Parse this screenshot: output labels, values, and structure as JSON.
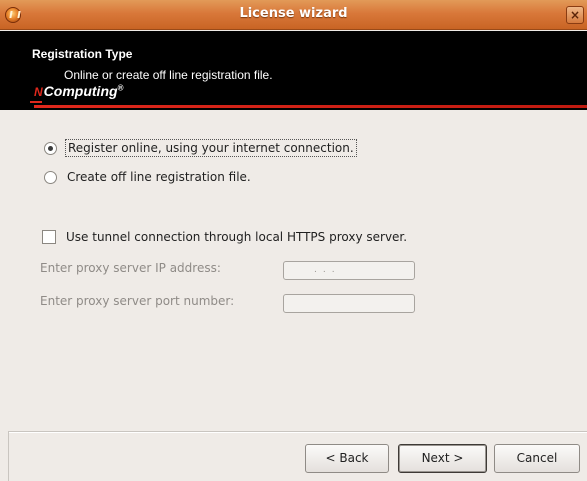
{
  "window": {
    "title": "License wizard",
    "close_label": "×"
  },
  "banner": {
    "title": "Registration Type",
    "subtitle": "Online or create off line registration file.",
    "logo_prefix": "N",
    "logo_text": "Computing",
    "logo_mark": "®"
  },
  "options": {
    "register_online": {
      "label": "Register online, using your internet connection.",
      "selected": true
    },
    "offline_file": {
      "label": "Create off line registration file.",
      "selected": false
    }
  },
  "tunnel": {
    "label": "Use tunnel connection through local HTTPS proxy server.",
    "checked": false
  },
  "proxy": {
    "ip_label": "Enter proxy server IP address:",
    "ip_value": "...",
    "port_label": "Enter proxy server port number:",
    "port_value": ""
  },
  "buttons": {
    "back": "< Back",
    "next": "Next >",
    "cancel": "Cancel"
  },
  "colors": {
    "titlebar": "#d9783a",
    "banner": "#000000",
    "accent_red": "#e0281c",
    "background": "#efebe7"
  }
}
